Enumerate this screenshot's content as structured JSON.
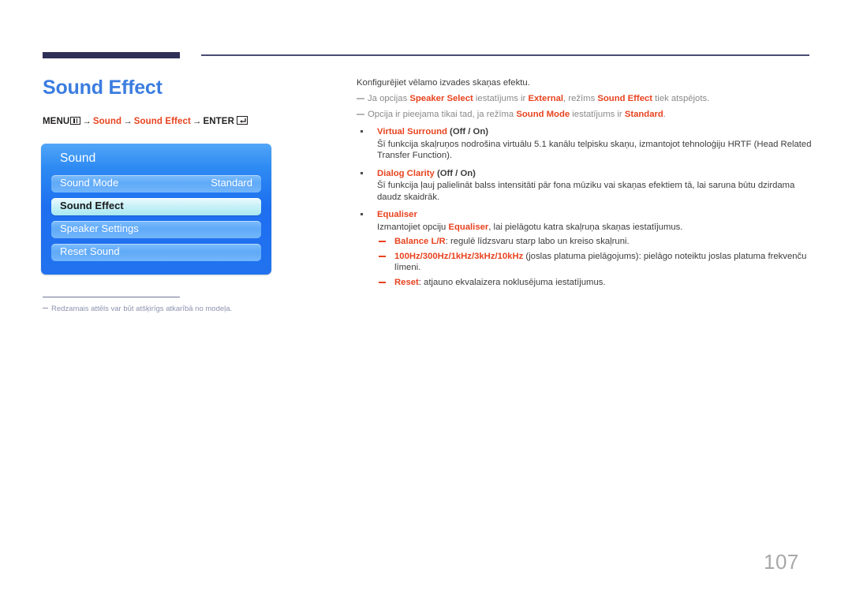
{
  "page": {
    "title": "Sound Effect",
    "number": "107"
  },
  "breadcrumb": {
    "menu_label": "MENU",
    "menu_icon": "menu-bars-icon",
    "arrow": "→",
    "item1": "Sound",
    "item2": "Sound Effect",
    "enter_label": "ENTER",
    "enter_icon": "enter-return-icon"
  },
  "osd": {
    "title": "Sound",
    "rows": [
      {
        "label": "Sound Mode",
        "value": "Standard",
        "selected": false
      },
      {
        "label": "Sound Effect",
        "value": "",
        "selected": true
      },
      {
        "label": "Speaker Settings",
        "value": "",
        "selected": false
      },
      {
        "label": "Reset Sound",
        "value": "",
        "selected": false
      }
    ]
  },
  "footnote": {
    "dash_icon": "dash-marker-icon",
    "text": "Redzamais attēls var būt atšķirīgs atkarībā no modeļa."
  },
  "content": {
    "intro": "Konfigurējiet vēlamo izvades skaņas efektu.",
    "notes": [
      {
        "p1": "Ja opcijas ",
        "b1": "Speaker Select",
        "p2": " iestatījums ir ",
        "b2": "External",
        "p3": ", režīms ",
        "b3": "Sound Effect",
        "p4": " tiek atspējots."
      },
      {
        "p1": "Opcija ir pieejama tikai tad, ja režīma ",
        "b1": "Sound Mode",
        "p2": " iestatījums ir ",
        "b2": "Standard",
        "p3": ".",
        "b3": "",
        "p4": ""
      }
    ],
    "bullets": [
      {
        "head_name": "Virtual Surround",
        "head_options": " (Off / On)",
        "body": "Šī funkcija skaļruņos nodrošina virtuālu 5.1 kanālu telpisku skaņu, izmantojot tehnoloģiju HRTF (Head Related Transfer Function)."
      },
      {
        "head_name": "Dialog Clarity",
        "head_options": " (Off / On)",
        "body": "Šī funkcija ļauj palielināt balss intensitāti pār fona mūziku vai skaņas efektiem tā, lai saruna būtu dzirdama daudz skaidrāk."
      },
      {
        "head_name": "Equaliser",
        "head_options": "",
        "body_pre": "Izmantojiet opciju ",
        "body_bold": "Equaliser",
        "body_post": ", lai pielāgotu katra skaļruņa skaņas iestatījumus."
      }
    ],
    "subbullets": [
      {
        "term": "Balance L/R",
        "rest": ": regulē līdzsvaru starp labo un kreiso skaļruni."
      },
      {
        "term": "100Hz/300Hz/1kHz/3kHz/10kHz",
        "rest": " (joslas platuma pielāgojums): pielāgo noteiktu joslas platuma frekvenču līmeni."
      },
      {
        "term": "Reset",
        "rest": ": atjauno ekvalaizera noklusējuma iestatījumus."
      }
    ]
  },
  "colors": {
    "accent_red": "#e8431f",
    "title_blue": "#3b7de0",
    "header_bar": "#2e3057",
    "osd_blue": "#2272ef",
    "osd_selected": "#cdf2f8"
  }
}
